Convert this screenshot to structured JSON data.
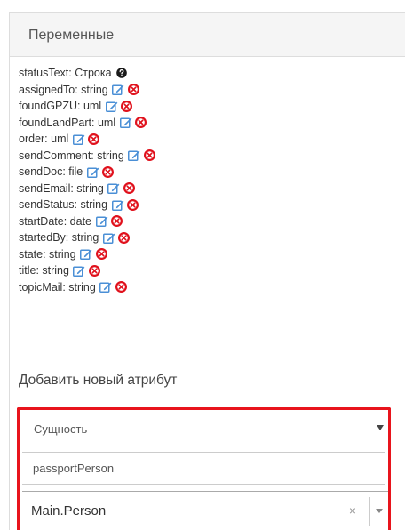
{
  "panel": {
    "title": "Переменные"
  },
  "variables": [
    {
      "text": "statusText: Строка",
      "icons": [
        "help-icon"
      ]
    },
    {
      "text": "assignedTo: string",
      "icons": [
        "edit-icon",
        "delete-icon"
      ]
    },
    {
      "text": "foundGPZU: uml",
      "icons": [
        "edit-icon",
        "delete-icon"
      ]
    },
    {
      "text": "foundLandPart: uml",
      "icons": [
        "edit-icon",
        "delete-icon"
      ]
    },
    {
      "text": "order: uml",
      "icons": [
        "edit-icon",
        "delete-icon"
      ]
    },
    {
      "text": "sendComment: string",
      "icons": [
        "edit-icon",
        "delete-icon"
      ]
    },
    {
      "text": "sendDoc: file",
      "icons": [
        "edit-icon",
        "delete-icon"
      ]
    },
    {
      "text": "sendEmail: string",
      "icons": [
        "edit-icon",
        "delete-icon"
      ]
    },
    {
      "text": "sendStatus: string",
      "icons": [
        "edit-icon",
        "delete-icon"
      ]
    },
    {
      "text": "startDate: date",
      "icons": [
        "edit-icon",
        "delete-icon"
      ]
    },
    {
      "text": "startedBy: string",
      "icons": [
        "edit-icon",
        "delete-icon"
      ]
    },
    {
      "text": "state: string",
      "icons": [
        "edit-icon",
        "delete-icon"
      ]
    },
    {
      "text": "title: string",
      "icons": [
        "edit-icon",
        "delete-icon"
      ]
    },
    {
      "text": "topicMail: string",
      "icons": [
        "edit-icon",
        "delete-icon"
      ]
    }
  ],
  "add_attribute": {
    "label": "Добавить новый атрибут",
    "kind_select": {
      "value": "Сущность"
    },
    "name_input": {
      "value": "passportPerson"
    },
    "type_select": {
      "value": "Main.Person",
      "clear_glyph": "×"
    }
  },
  "colors": {
    "edit_icon": "#4a8fd6",
    "delete_icon": "#e0111c",
    "highlight_border": "#e8141c"
  }
}
